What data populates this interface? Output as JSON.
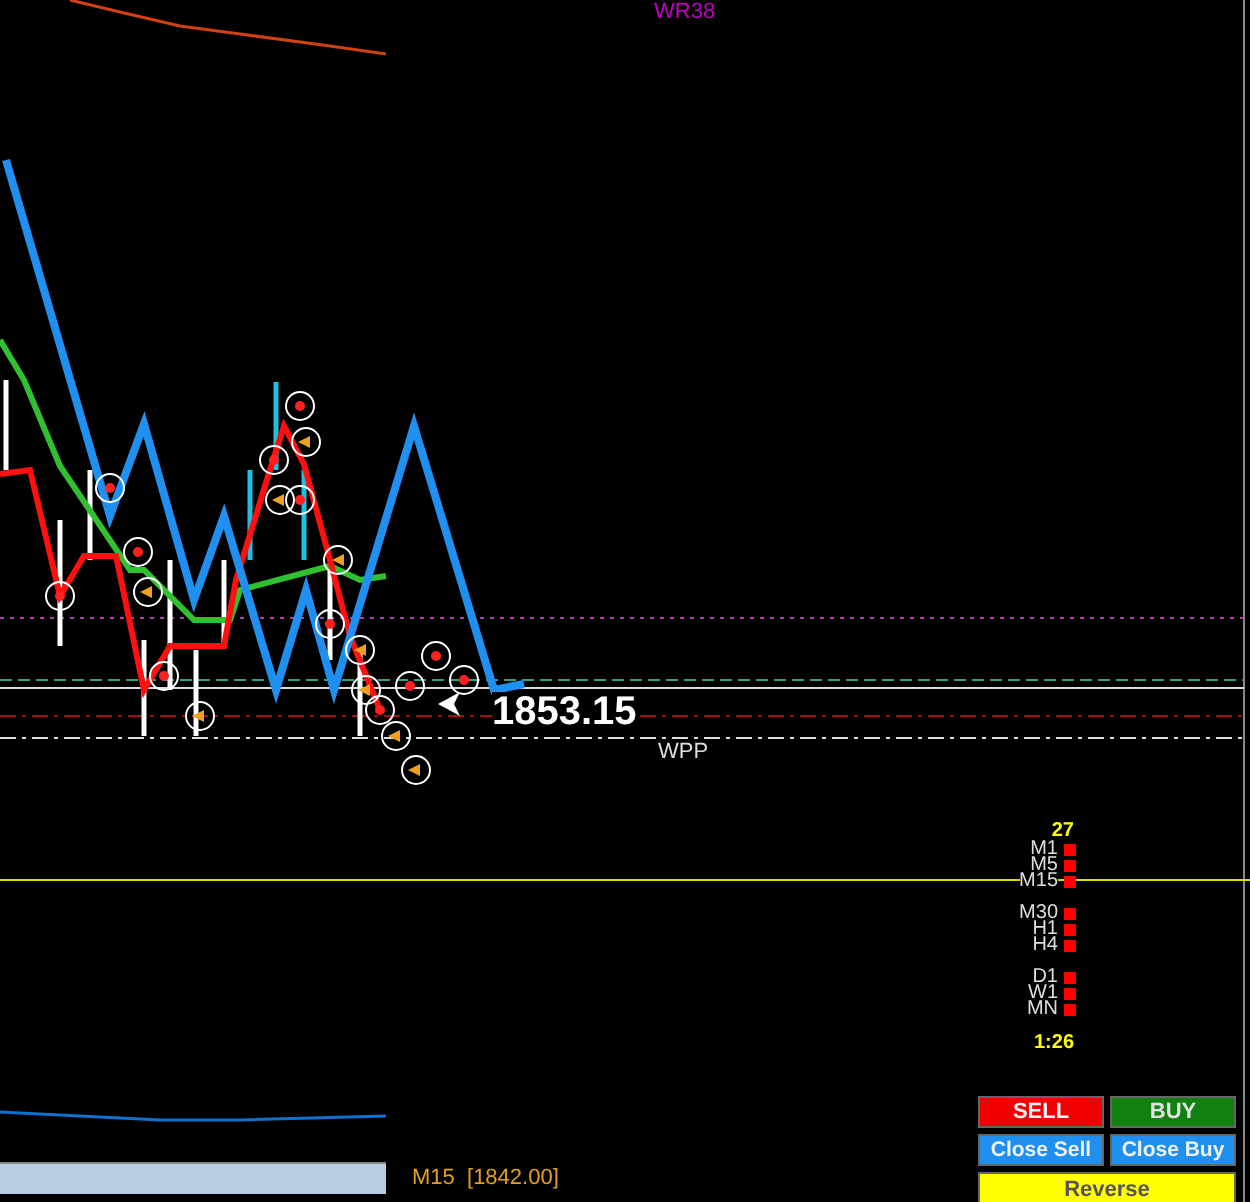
{
  "chart": {
    "top_label": "WR38",
    "price_label": "1853.15",
    "level_label": "WPP",
    "footer_label": "M15  [1842.00]"
  },
  "timeframes": {
    "count": "27",
    "timer": "1:26",
    "groups": [
      {
        "items": [
          {
            "label": "M1",
            "color": "#ff0000"
          },
          {
            "label": "M5",
            "color": "#ff0000"
          },
          {
            "label": "M15",
            "color": "#ff0000"
          }
        ]
      },
      {
        "items": [
          {
            "label": "M30",
            "color": "#ff0000"
          },
          {
            "label": "H1",
            "color": "#ff0000"
          },
          {
            "label": "H4",
            "color": "#ff0000"
          }
        ]
      },
      {
        "items": [
          {
            "label": "D1",
            "color": "#ff0000"
          },
          {
            "label": "W1",
            "color": "#ff0000"
          },
          {
            "label": "MN",
            "color": "#ff0000"
          }
        ]
      }
    ]
  },
  "buttons": [
    {
      "label": "SELL",
      "kind": "sell"
    },
    {
      "label": "BUY",
      "kind": "buy"
    },
    {
      "label": "Close Sell",
      "kind": "close"
    },
    {
      "label": "Close Buy",
      "kind": "close"
    },
    {
      "label": "Reverse",
      "kind": "reverse"
    }
  ]
}
